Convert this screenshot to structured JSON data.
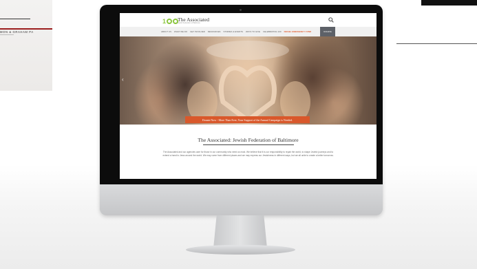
{
  "background": {
    "card_brand_text": "MON & GRAHAM",
    "card_brand_suffix": "PA",
    "accent_red": "#9b1c1c"
  },
  "site": {
    "logo": {
      "number": "100",
      "name": "The Associated",
      "tagline": "Jewish Federation of Baltimore"
    },
    "search_icon": "search-icon",
    "nav": {
      "items": [
        "ABOUT US",
        "WHAT WE DO",
        "GET INVOLVED",
        "RESOURCES",
        "STORIES & EVENTS",
        "WAYS TO GIVE",
        "CELEBRATING 100"
      ],
      "emergency": "ISRAEL EMERGENCY FUND",
      "donate": "DONATE"
    },
    "hero": {
      "banner_text": "Donate Now - More Than Ever, Your Support of the Annual Campaign is Needed.",
      "prev_arrow": "‹"
    },
    "heading": "The Associated: Jewish Federation of Baltimore",
    "description": "The Associated and our agencies care for those in our community who need us most. We believe that it is our responsibility to repair the world, to shape Jewish journeys and to extend a hand to Jews around the world. We may come from different places and we may express our Jewishness in different ways, but we all unite to create a better tomorrow.",
    "colors": {
      "logo_green": "#8cc63f",
      "banner_orange": "#d9582b",
      "donate_gray": "#5d6168"
    }
  }
}
